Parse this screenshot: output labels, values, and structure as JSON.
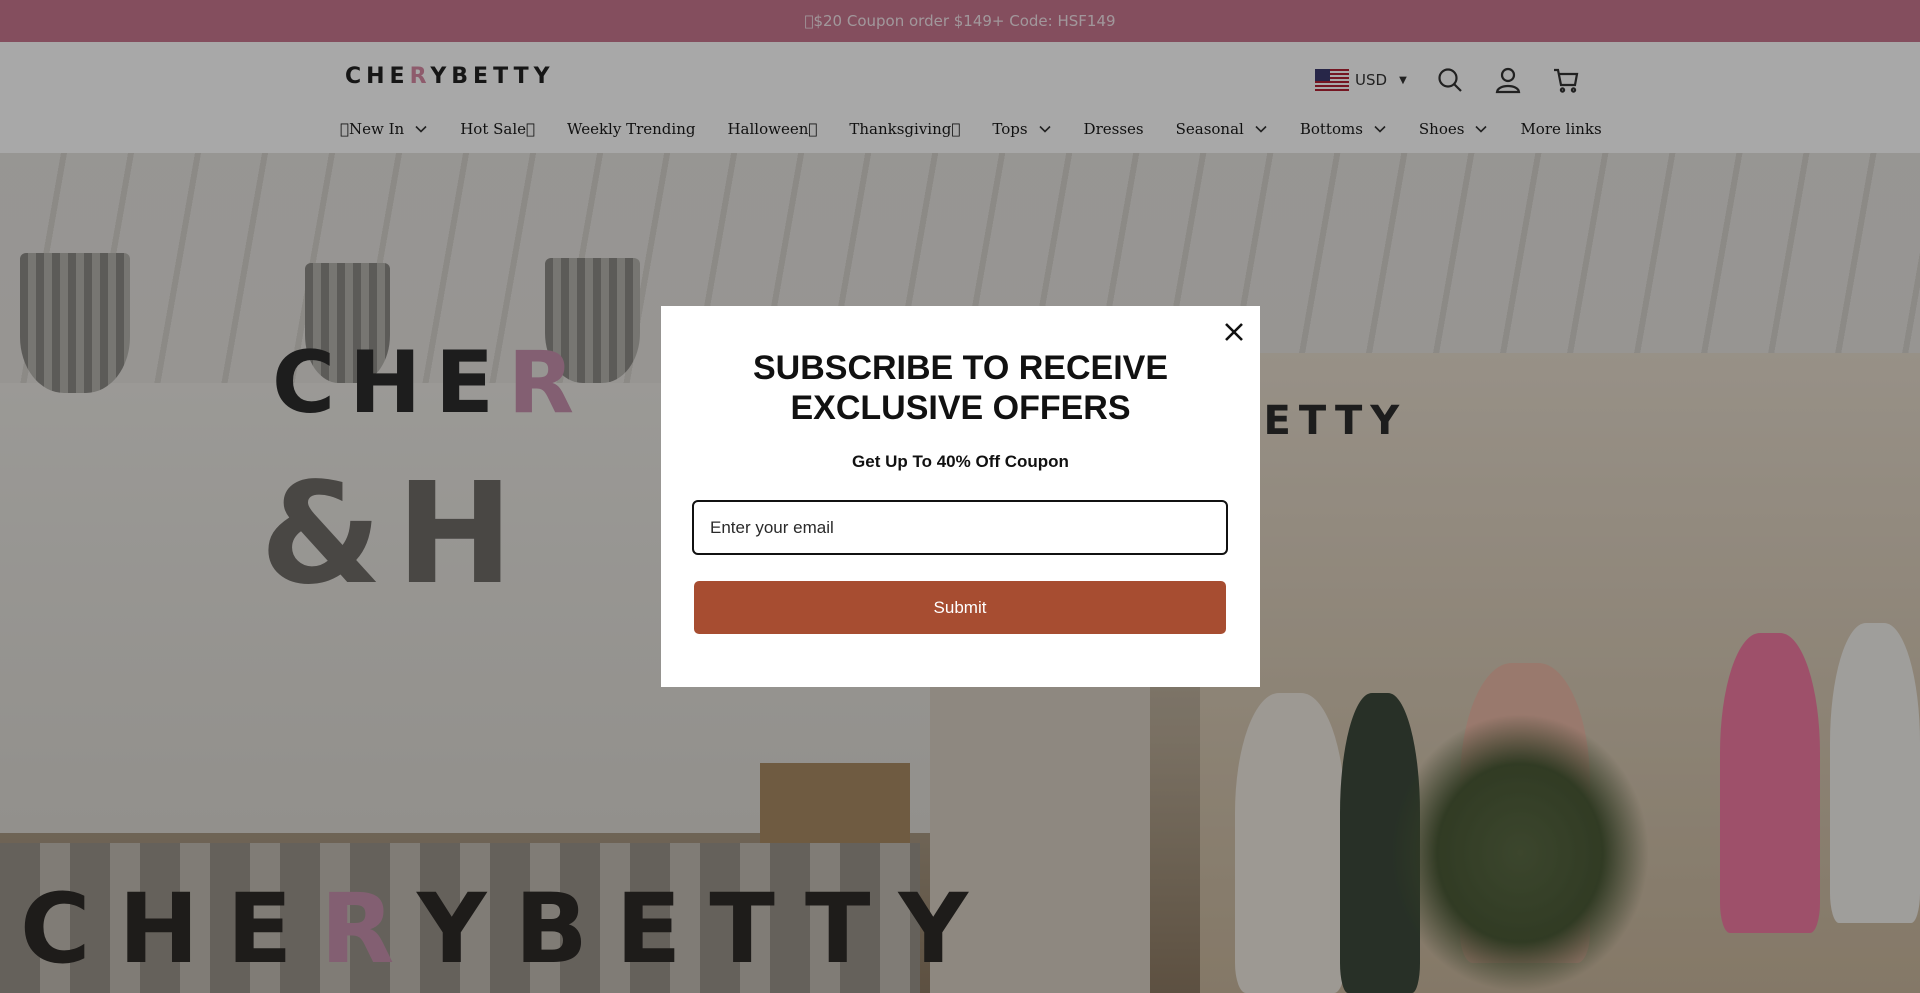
{
  "announcement": {
    "text": "\u0000$20 Coupon order $149+ Code: HSF149"
  },
  "header": {
    "logo_pre": "CHE",
    "logo_r": "R",
    "logo_post": "YBETTY",
    "currency": "USD",
    "icons": [
      "search-icon",
      "account-icon",
      "cart-icon"
    ]
  },
  "nav": {
    "items": [
      {
        "label": "\u0000New In",
        "has_dropdown": true
      },
      {
        "label": "Hot Sale\u0000",
        "has_dropdown": false
      },
      {
        "label": "Weekly Trending",
        "has_dropdown": false
      },
      {
        "label": "Halloween\u0000",
        "has_dropdown": false
      },
      {
        "label": "Thanksgiving\u0000",
        "has_dropdown": false
      },
      {
        "label": "Tops",
        "has_dropdown": true
      },
      {
        "label": "Dresses",
        "has_dropdown": false
      },
      {
        "label": "Seasonal",
        "has_dropdown": true
      },
      {
        "label": "Bottoms",
        "has_dropdown": true
      },
      {
        "label": "Shoes",
        "has_dropdown": true
      },
      {
        "label": "More links",
        "has_dropdown": false
      }
    ]
  },
  "hero": {
    "wall_text_1_pre": "CHE",
    "wall_text_1_r": "R",
    "wall_text_2": "&H",
    "wall_text_3": "BETTY",
    "counter_pre": "CHE",
    "counter_r": "R",
    "counter_post": "YBETTY"
  },
  "modal": {
    "title_line1": "SUBSCRIBE TO RECEIVE",
    "title_line2": "EXCLUSIVE OFFERS",
    "subtitle": "Get Up To 40% Off Coupon",
    "email_placeholder": "Enter your email",
    "submit_label": "Submit"
  },
  "colors": {
    "announcement_bg": "#c9778f",
    "submit_bg": "#a74d31",
    "logo_accent": "#d88aa5"
  }
}
